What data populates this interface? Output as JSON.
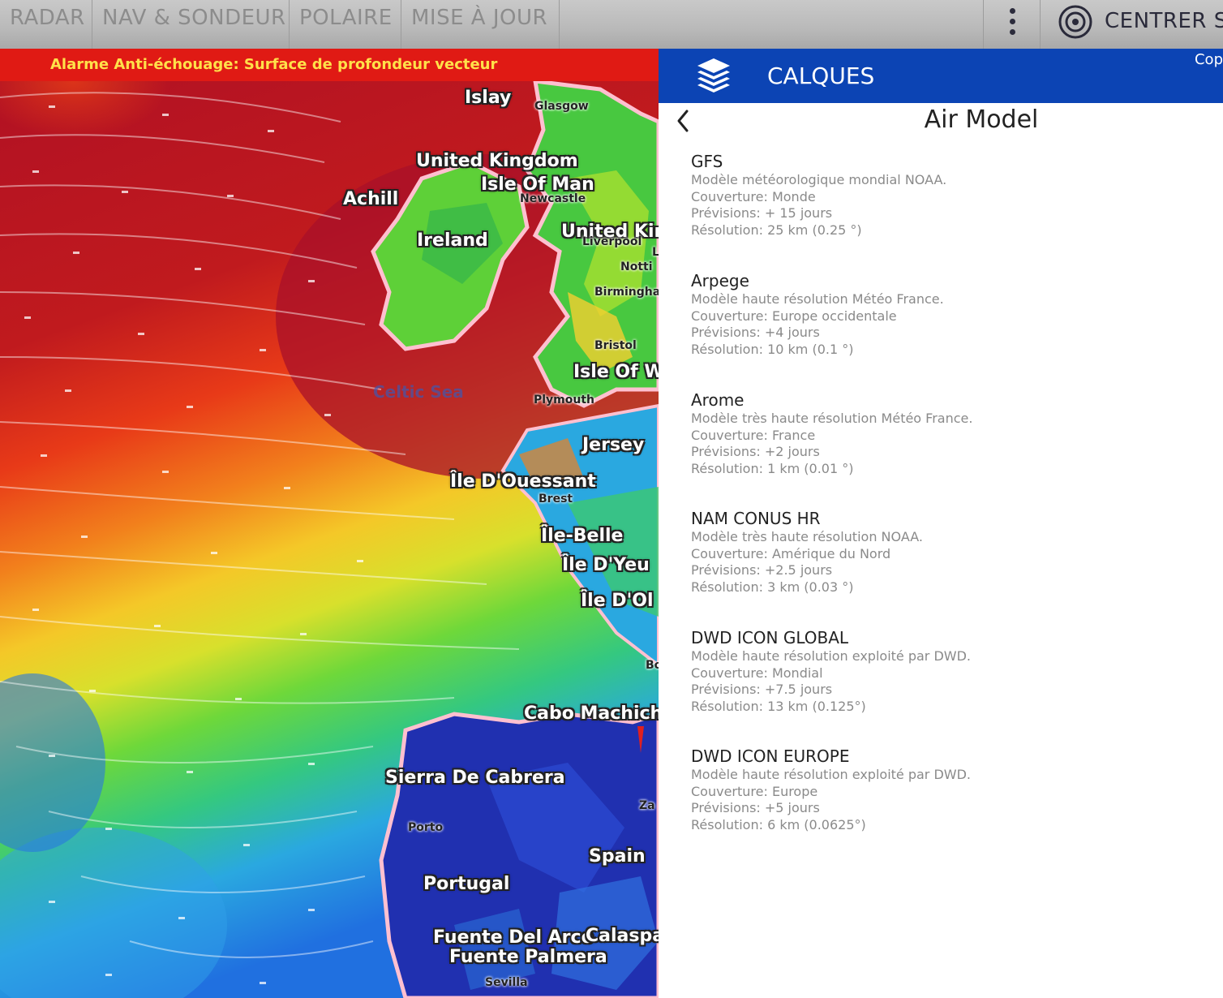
{
  "toolbar": {
    "tabs": [
      "RADAR",
      "NAV & SONDEUR",
      "POLAIRE",
      "MISE À JOUR"
    ],
    "center_label": "CENTRER S"
  },
  "alarm": {
    "text": "Alarme Anti-échouage: Surface de profondeur vecteur"
  },
  "map": {
    "places": [
      "Islay",
      "United Kingdom",
      "Isle Of Man",
      "Achill",
      "Ireland",
      "United Kin",
      "Isle Of W",
      "Jersey",
      "Île D'Ouessant",
      "Île-Belle",
      "Île D'Yeu",
      "Île D'Ol",
      "Cabo Machich",
      "Sierra De Cabrera",
      "Spain",
      "Portugal",
      "Fuente Del Arco",
      "Calaspa",
      "Fuente Palmera"
    ],
    "cities": [
      "Glasgow",
      "Newcastle",
      "Liverpool",
      "Notti",
      "Birmingha",
      "Bristol",
      "Plymouth",
      "Brest",
      "Porto",
      "Bo",
      "Sevilla",
      "Za",
      "L"
    ],
    "sea": "Celtic Sea"
  },
  "panel": {
    "title": "CALQUES",
    "copyright": "Cop",
    "subtitle": "Air Model",
    "models": [
      {
        "name": "GFS",
        "lines": [
          "Modèle météorologique mondial NOAA.",
          "Couverture: Monde",
          "Prévisions: + 15 jours",
          "Résolution: 25 km (0.25 °)"
        ]
      },
      {
        "name": "Arpege",
        "lines": [
          "Modèle haute résolution Météo France.",
          "Couverture: Europe occidentale",
          "Prévisions: +4 jours",
          "Résolution: 10 km (0.1 °)"
        ]
      },
      {
        "name": "Arome",
        "lines": [
          "Modèle très haute résolution Météo France.",
          "Couverture: France",
          "Prévisions: +2 jours",
          "Résolution: 1 km (0.01 °)"
        ]
      },
      {
        "name": "NAM CONUS HR",
        "lines": [
          "Modèle très haute résolution NOAA.",
          "Couverture: Amérique du Nord",
          "Prévisions: +2.5 jours",
          "Résolution: 3 km (0.03 °)"
        ]
      },
      {
        "name": "DWD ICON GLOBAL",
        "lines": [
          "Modèle haute résolution exploité par DWD.",
          "Couverture: Mondial",
          "Prévisions: +7.5 jours",
          "Résolution: 13 km (0.125°)"
        ]
      },
      {
        "name": "DWD ICON EUROPE",
        "lines": [
          "Modèle haute résolution exploité par DWD.",
          "Couverture: Europe",
          "Prévisions: +5 jours",
          "Résolution: 6 km (0.0625°)"
        ]
      }
    ]
  },
  "colors": {
    "header": "#0c44b4",
    "alarm": "#e01a14",
    "alarm_text": "#ffe14a"
  }
}
